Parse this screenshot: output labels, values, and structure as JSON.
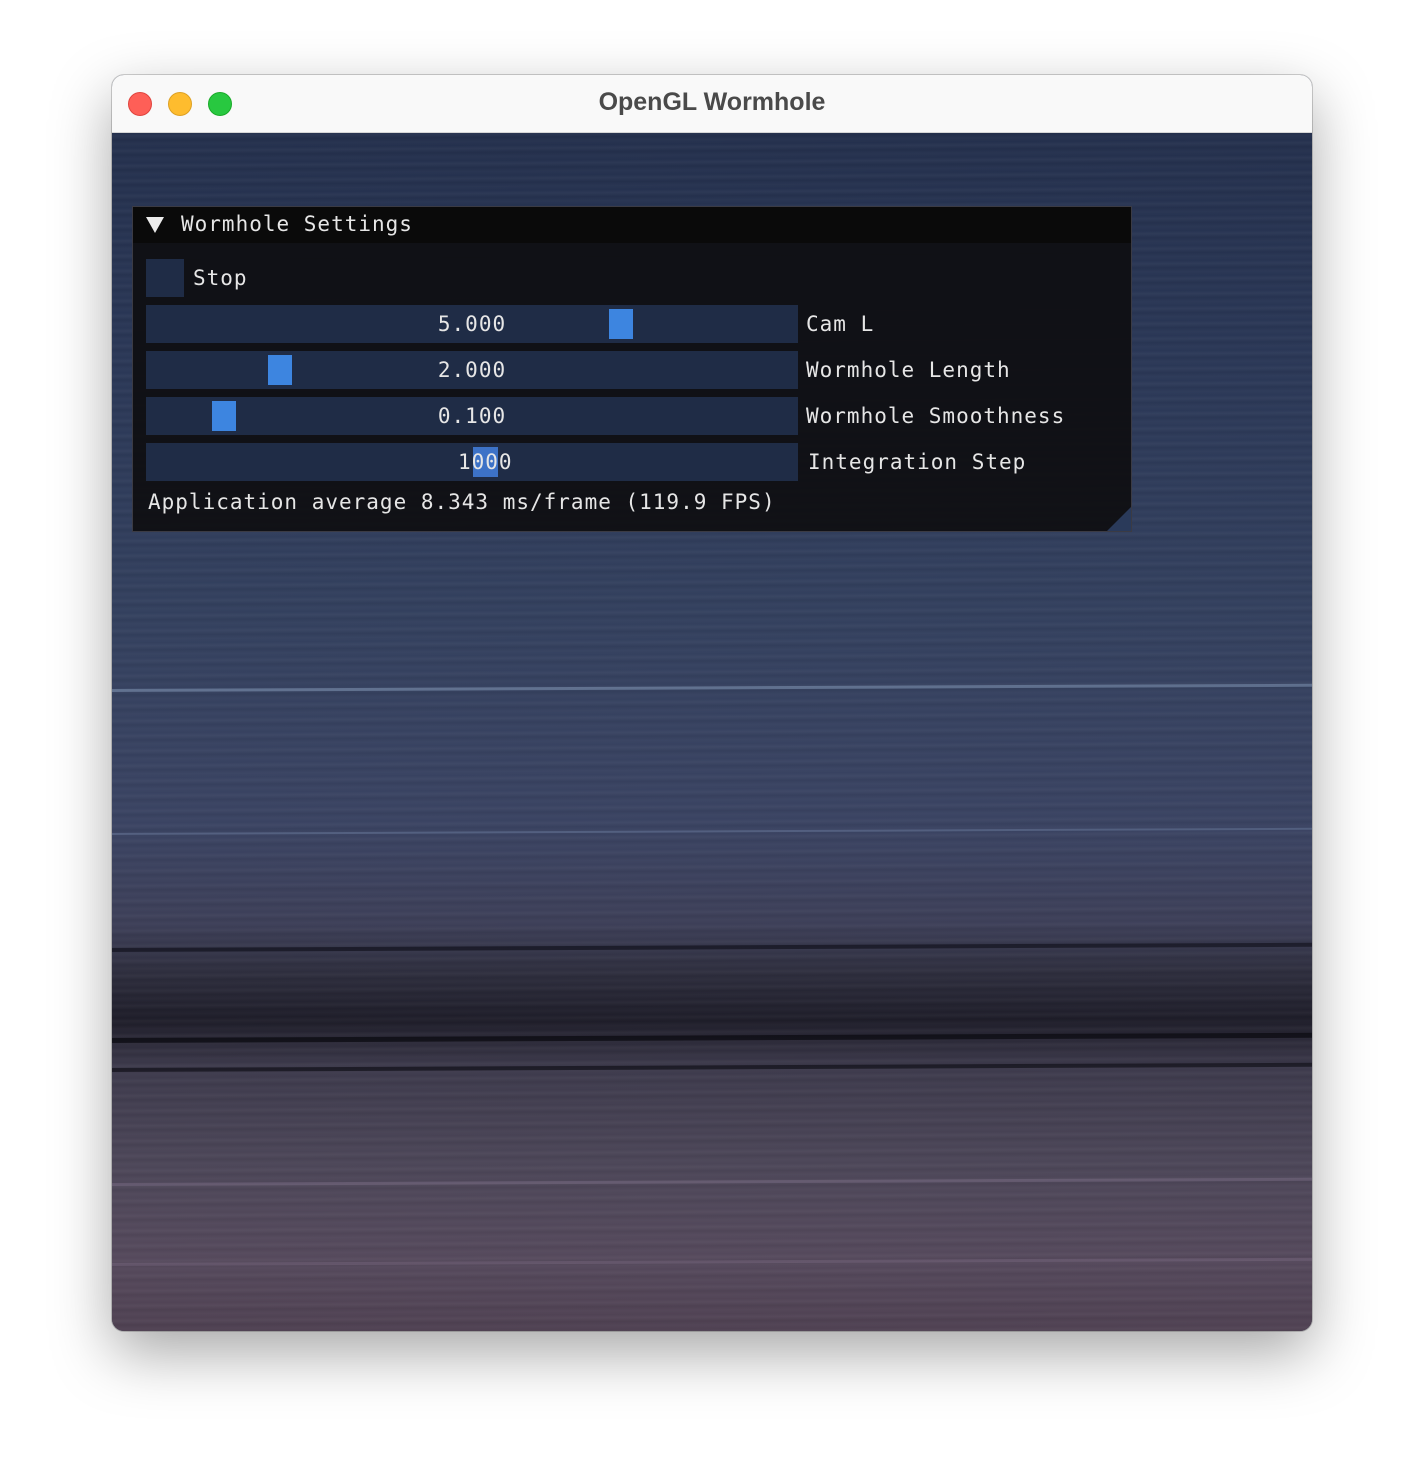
{
  "window": {
    "title": "OpenGL Wormhole"
  },
  "panel": {
    "header_title": "Wormhole Settings",
    "checkbox": {
      "label": "Stop",
      "checked": false
    },
    "sliders": [
      {
        "label": "Cam L",
        "value": "5.000",
        "fraction": 0.74
      },
      {
        "label": "Wormhole Length",
        "value": "2.000",
        "fraction": 0.19
      },
      {
        "label": "Wormhole Smoothness",
        "value": "0.100",
        "fraction": 0.1
      }
    ],
    "integration_input": {
      "label": "Integration Step",
      "value": "1000"
    },
    "status_text": "Application average 8.343 ms/frame (119.9 FPS)"
  },
  "colors": {
    "accent": "#3d85e0",
    "frame_bg": "#1f2c46",
    "panel_bg": "#0f0f12"
  }
}
